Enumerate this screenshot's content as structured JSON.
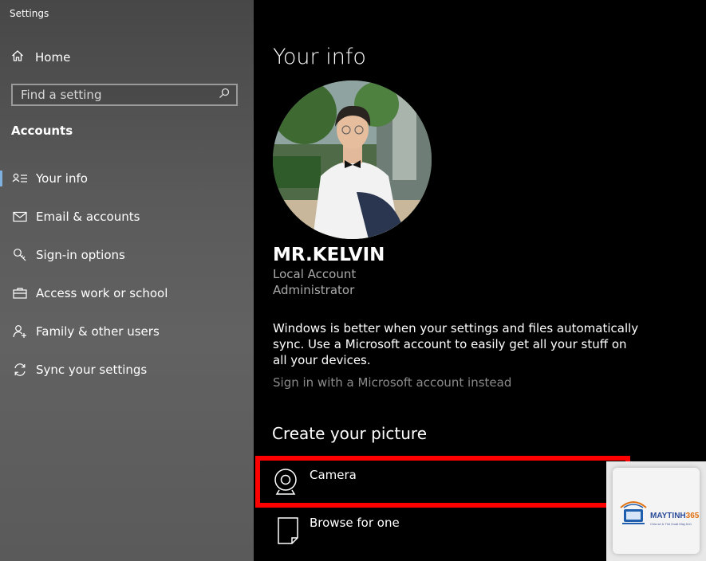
{
  "window": {
    "title": "Settings"
  },
  "sidebar": {
    "home_label": "Home",
    "search_placeholder": "Find a setting",
    "section_title": "Accounts",
    "items": [
      {
        "label": "Your info",
        "icon": "your-info-icon",
        "active": true
      },
      {
        "label": "Email & accounts",
        "icon": "email-icon",
        "active": false
      },
      {
        "label": "Sign-in options",
        "icon": "key-icon",
        "active": false
      },
      {
        "label": "Access work or school",
        "icon": "briefcase-icon",
        "active": false
      },
      {
        "label": "Family & other users",
        "icon": "add-person-icon",
        "active": false
      },
      {
        "label": "Sync your settings",
        "icon": "sync-icon",
        "active": false
      }
    ]
  },
  "main": {
    "title": "Your info",
    "user": {
      "name": "MR.KELVIN",
      "account_type": "Local Account",
      "role": "Administrator"
    },
    "sync_message": "Windows is better when your settings and files automatically sync. Use a Microsoft account to easily get all your stuff on all your devices.",
    "ms_link": "Sign in with a Microsoft account instead",
    "create_picture_title": "Create your picture",
    "picture_options": [
      {
        "label": "Camera",
        "icon": "camera-icon"
      },
      {
        "label": "Browse for one",
        "icon": "file-icon"
      }
    ]
  },
  "watermark": {
    "brand": "MAYTINH",
    "brand_suffix": "365",
    "tagline": "Chia sẻ & Thủ thuật Máy tính"
  },
  "colors": {
    "highlight": "#ff0000",
    "accent": "#7fb0e0",
    "main_bg": "#000000"
  }
}
